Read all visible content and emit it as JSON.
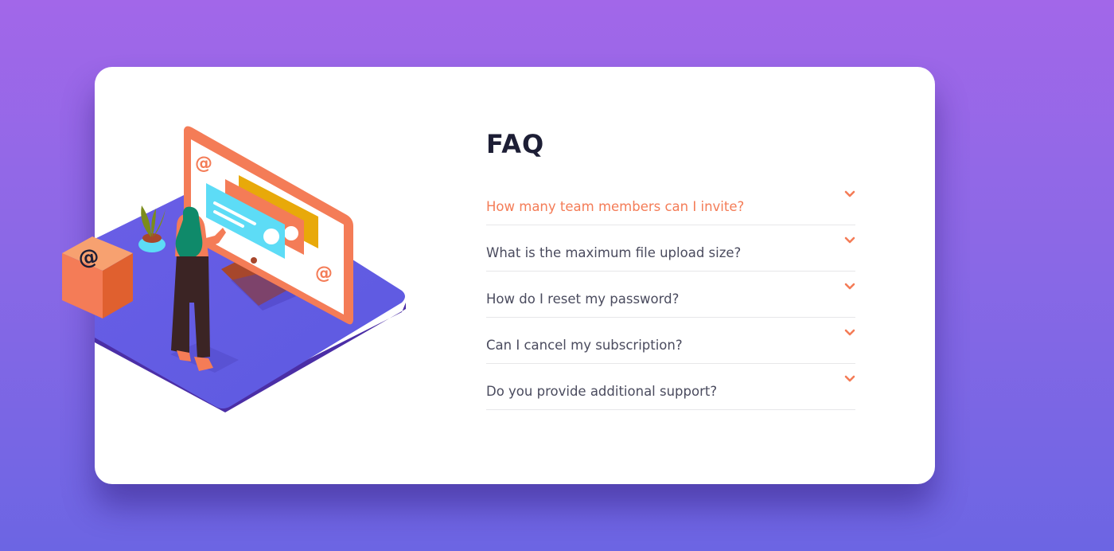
{
  "faq": {
    "title": "FAQ",
    "items": [
      {
        "question": "How many team members can I invite?",
        "active": true
      },
      {
        "question": "What is the maximum file upload size?",
        "active": false
      },
      {
        "question": "How do I reset my password?",
        "active": false
      },
      {
        "question": "Can I cancel my subscription?",
        "active": false
      },
      {
        "question": "Do you provide additional support?",
        "active": false
      }
    ]
  },
  "colors": {
    "background_top": "#a267e9",
    "background_bottom": "#6c65e3",
    "card": "#ffffff",
    "heading": "#1d1e35",
    "question_text": "#4a4b5e",
    "accent": "#f47c57",
    "divider": "#e7e7e9"
  },
  "icons": {
    "chevron": "chevron-down-icon",
    "illustration": "woman-at-computer-illustration",
    "box": "at-sign-box-icon"
  }
}
